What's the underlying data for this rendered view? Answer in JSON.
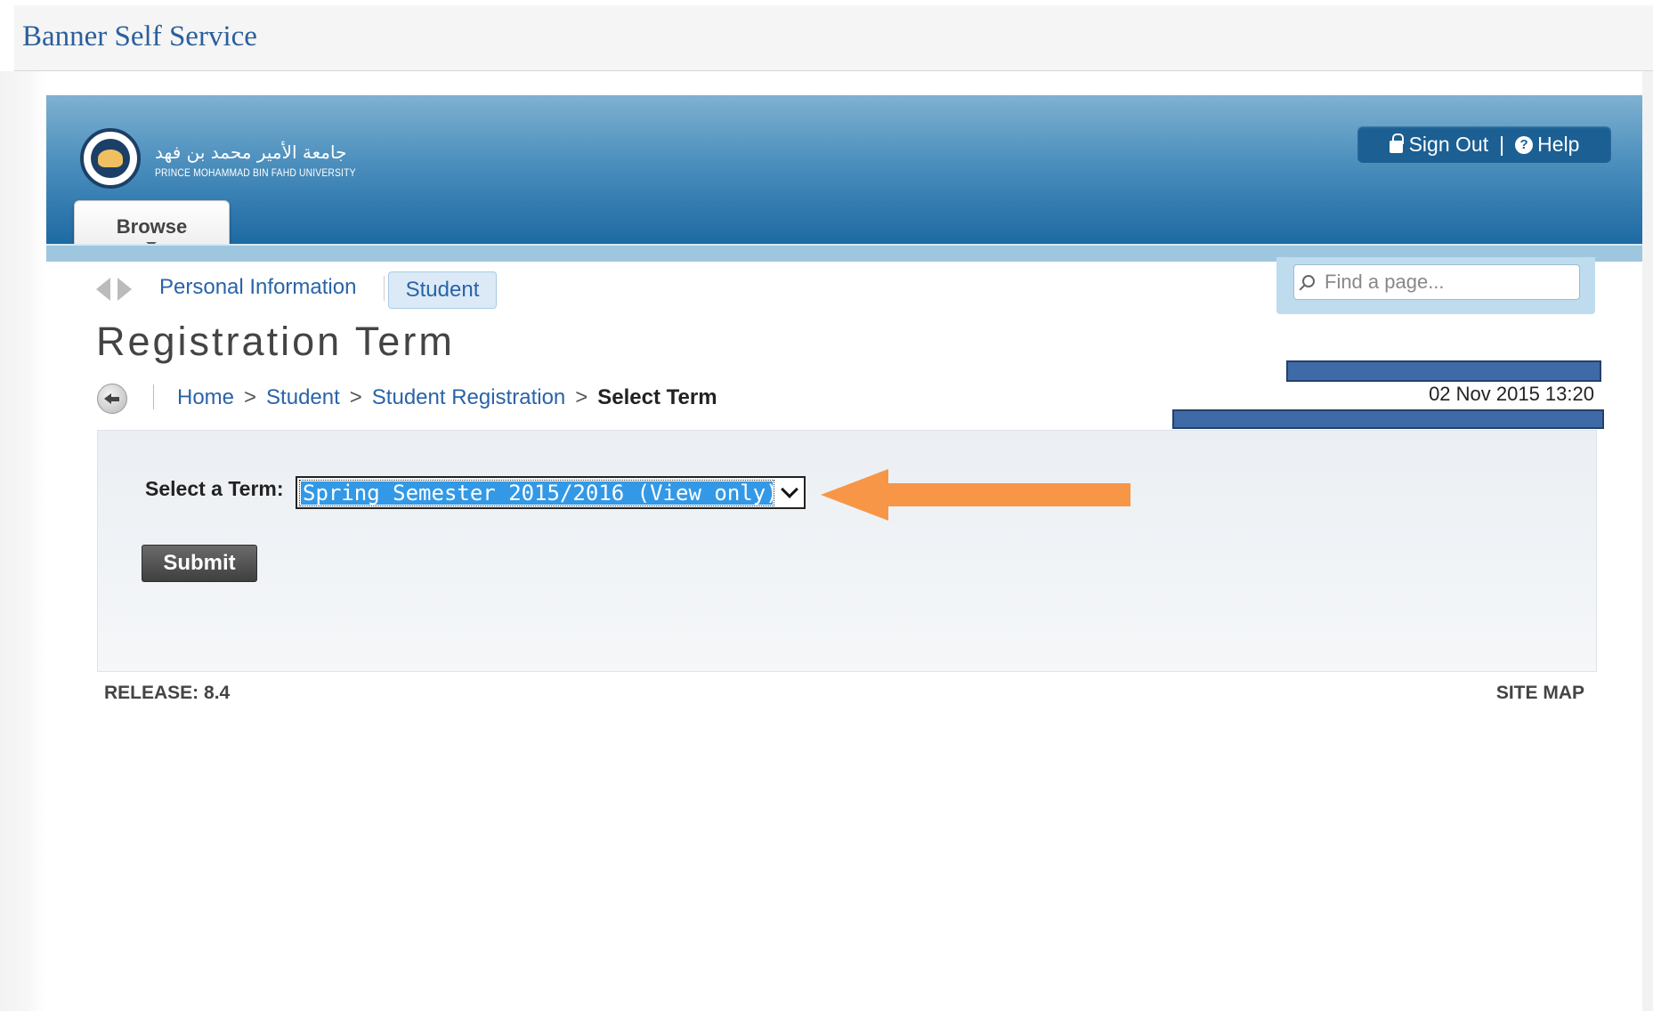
{
  "app": {
    "title": "Banner Self Service"
  },
  "header": {
    "logo_ar": "جامعة الأمير محمد بن فهد",
    "logo_en": "PRINCE MOHAMMAD BIN FAHD UNIVERSITY",
    "browse_label": "Browse",
    "sign_out_label": "Sign Out",
    "separator": "|",
    "help_label": "Help",
    "help_glyph": "?"
  },
  "search": {
    "placeholder": "Find a page..."
  },
  "tabs": [
    {
      "label": "Personal Information",
      "active": false
    },
    {
      "label": "Student",
      "active": true
    }
  ],
  "page": {
    "title": "Registration Term",
    "datetime": "02 Nov 2015 13:20"
  },
  "breadcrumb": {
    "items": [
      "Home",
      "Student",
      "Student Registration"
    ],
    "separator": ">",
    "current": "Select Term"
  },
  "form": {
    "term_label": "Select a Term:",
    "term_selected": "Spring Semester 2015/2016 (View only)",
    "submit_label": "Submit"
  },
  "footer": {
    "release": "RELEASE: 8.4",
    "site_map": "SITE MAP"
  },
  "colors": {
    "brand_blue": "#1d6aa3",
    "link_blue": "#2a63a8",
    "selection_blue": "#3399e6",
    "annotation_orange": "#f79646",
    "redaction_blue": "#3e6aa8"
  }
}
